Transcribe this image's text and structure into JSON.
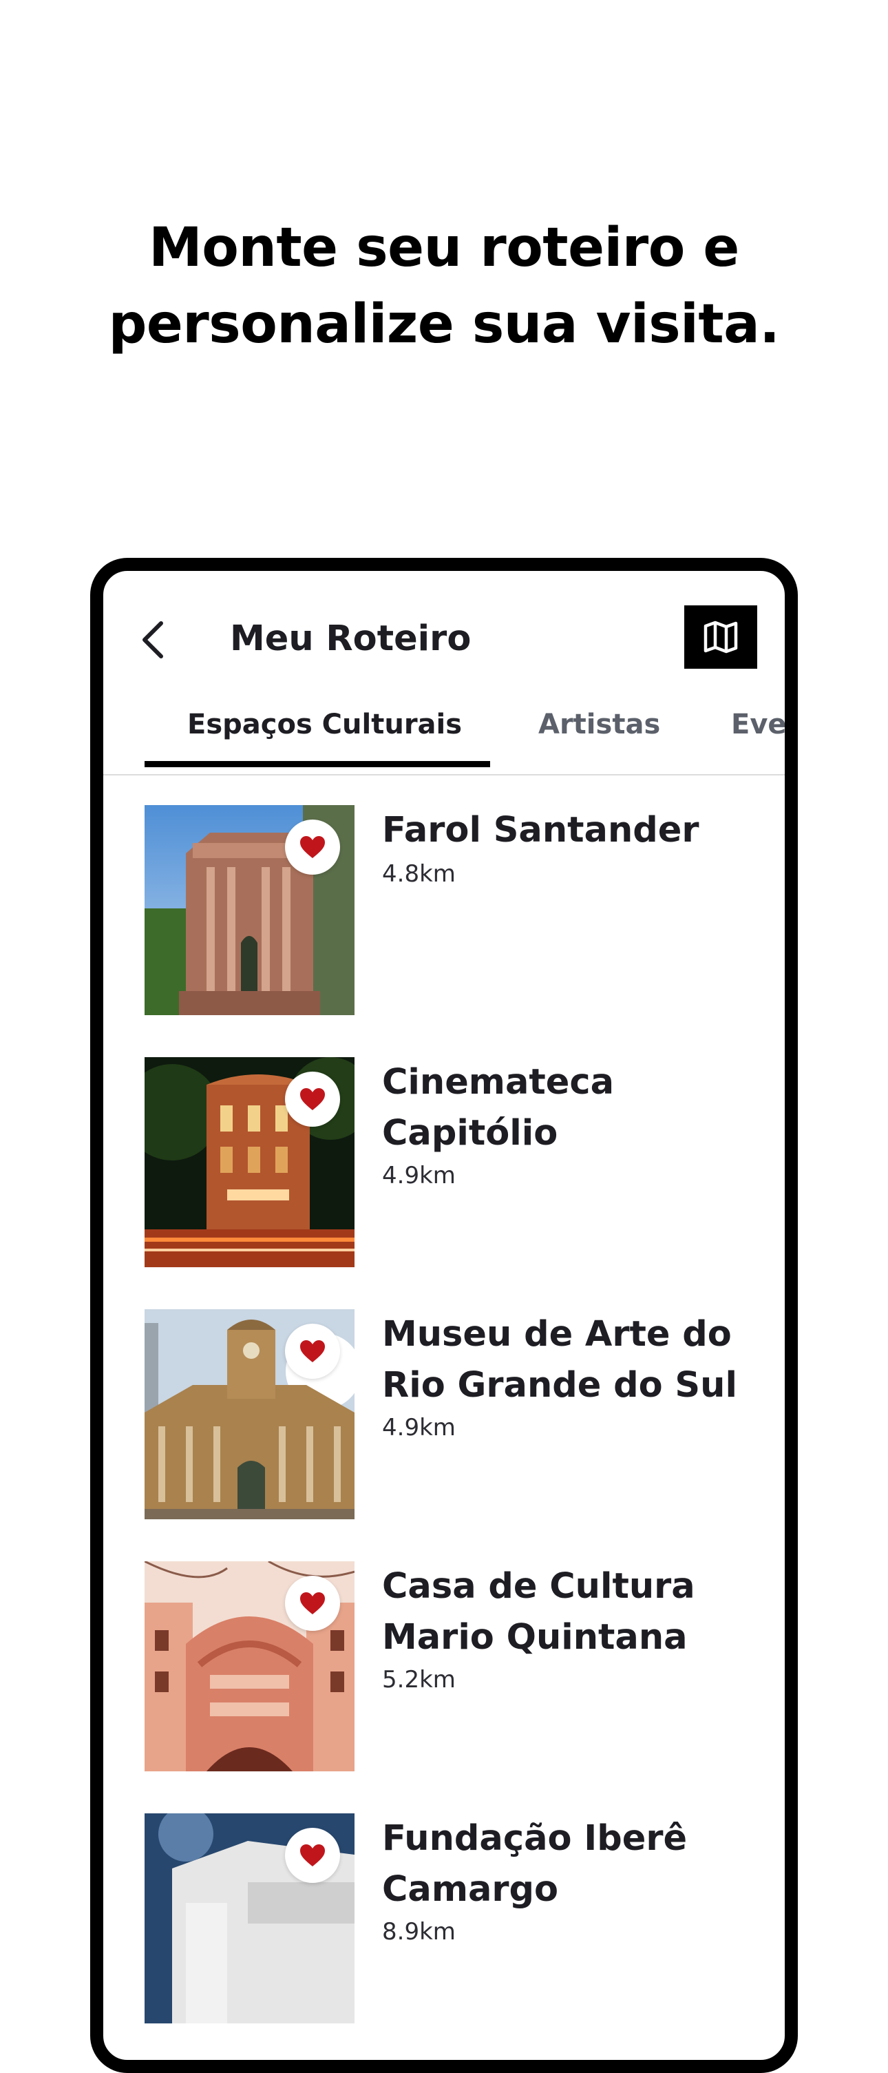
{
  "headline": {
    "line1": "Monte seu roteiro e",
    "line2": "personalize sua visita."
  },
  "header": {
    "title": "Meu Roteiro",
    "back_icon": "chevron-left-icon",
    "map_icon": "map-icon"
  },
  "tabs": [
    {
      "label": "Espaços Culturais",
      "active": true
    },
    {
      "label": "Artistas",
      "active": false
    },
    {
      "label": "Eve",
      "active": false
    }
  ],
  "places": [
    {
      "name": "Farol Santander",
      "distance": "4.8km",
      "favorite": true
    },
    {
      "name": "Cinemateca Capitólio",
      "distance": "4.9km",
      "favorite": true
    },
    {
      "name": "Museu de Arte do Rio Grande do Sul",
      "distance": "4.9km",
      "favorite": true
    },
    {
      "name": "Casa de Cultura Mario Quintana",
      "distance": "5.2km",
      "favorite": true
    },
    {
      "name": "Fundação Iberê Camargo",
      "distance": "8.9km",
      "favorite": true
    }
  ],
  "colors": {
    "heart": "#c0161b",
    "tab_active": "#1d1d23",
    "tab_inactive": "#5b606a"
  }
}
